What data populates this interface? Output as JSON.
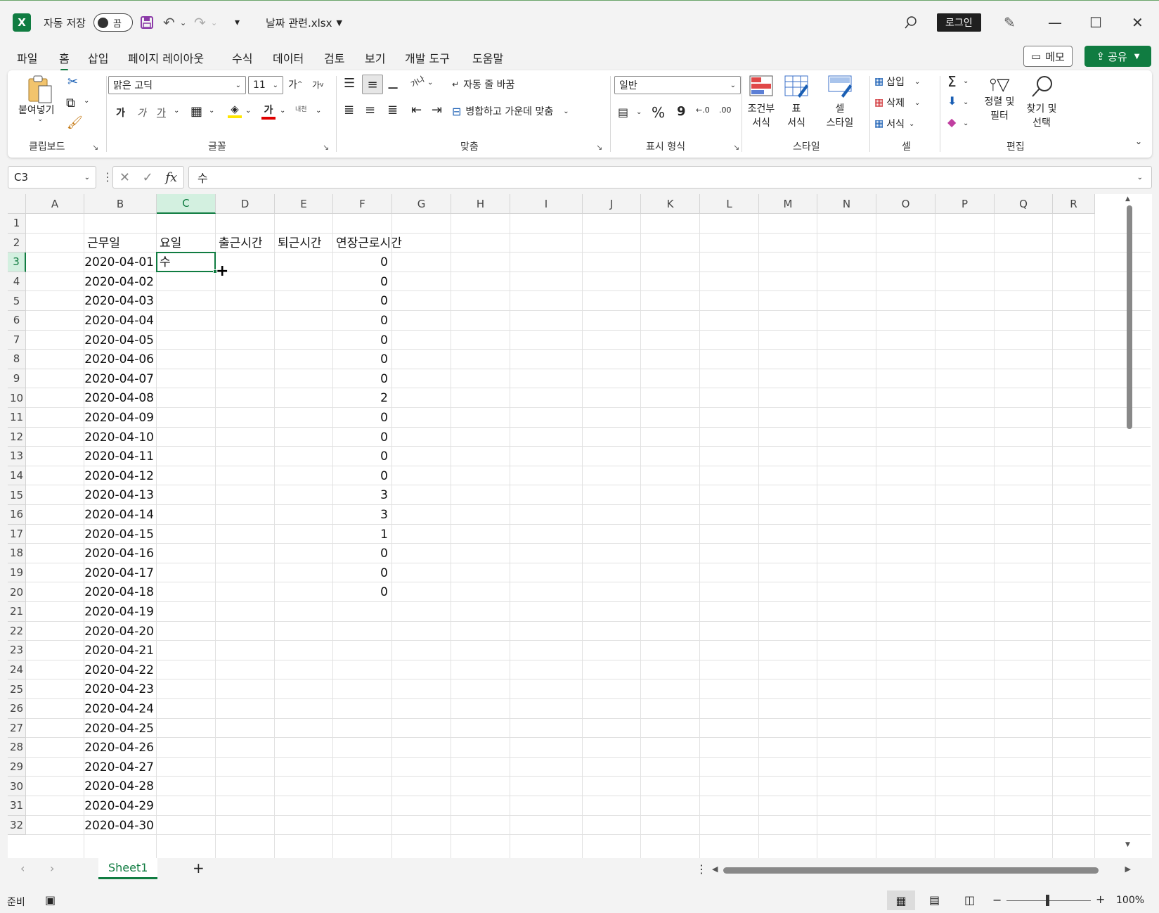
{
  "title_bar": {
    "app_icon": "X",
    "autosave_label": "자동 저장",
    "autosave_state": "끔",
    "filename": "날짜 관련.xlsx",
    "login_label": "로그인"
  },
  "menu": {
    "tabs": [
      "파일",
      "홈",
      "삽입",
      "페이지 레이아웃",
      "수식",
      "데이터",
      "검토",
      "보기",
      "개발 도구",
      "도움말"
    ],
    "active": "홈",
    "memo_label": "메모",
    "share_label": "공유"
  },
  "ribbon": {
    "clipboard": {
      "paste": "붙여넣기",
      "label": "클립보드"
    },
    "font": {
      "name": "맑은 고딕",
      "size": "11",
      "grow": "가",
      "shrink": "가",
      "bold": "가",
      "italic": "가",
      "underline": "가",
      "font_color": "가",
      "phonetic": "내천",
      "label": "글꼴"
    },
    "alignment": {
      "wrap": "자동 줄 바꿈",
      "merge": "병합하고 가운데 맞춤",
      "orientation": "가나",
      "label": "맞춤"
    },
    "number": {
      "format": "일반",
      "percent": "%",
      "comma": "9",
      "inc_decimal": "←.0",
      "dec_decimal": ".00",
      "label": "표시 형식"
    },
    "styles": {
      "conditional_top": "조건부",
      "conditional_bottom": "서식",
      "table_top": "표",
      "table_bottom": "서식",
      "cell_top": "셀",
      "cell_bottom": "스타일",
      "label": "스타일"
    },
    "cells": {
      "insert": "삽입",
      "delete": "삭제",
      "format": "서식",
      "label": "셀"
    },
    "editing": {
      "sum": "Σ",
      "sort_top": "정렬 및",
      "sort_bottom": "필터",
      "find_top": "찾기 및",
      "find_bottom": "선택",
      "label": "편집"
    }
  },
  "formula_bar": {
    "name_box": "C3",
    "fx": "fx",
    "content": "수"
  },
  "grid": {
    "columns": [
      "A",
      "B",
      "C",
      "D",
      "E",
      "F",
      "G",
      "H",
      "I",
      "J",
      "K",
      "L",
      "M",
      "N",
      "O",
      "P",
      "Q",
      "R"
    ],
    "selected_column": "C",
    "selected_row": 3,
    "headers": {
      "B": "근무일",
      "C": "요일",
      "D": "출근시간",
      "E": "퇴근시간",
      "F": "연장근로시간"
    },
    "rows": [
      {
        "n": "1",
        "b": "",
        "c": "",
        "f": ""
      },
      {
        "n": "2",
        "b": "",
        "c": "",
        "f": ""
      },
      {
        "n": "3",
        "b": "2020-04-01",
        "c": "수",
        "f": "0"
      },
      {
        "n": "4",
        "b": "2020-04-02",
        "c": "",
        "f": "0"
      },
      {
        "n": "5",
        "b": "2020-04-03",
        "c": "",
        "f": "0"
      },
      {
        "n": "6",
        "b": "2020-04-04",
        "c": "",
        "f": "0"
      },
      {
        "n": "7",
        "b": "2020-04-05",
        "c": "",
        "f": "0"
      },
      {
        "n": "8",
        "b": "2020-04-06",
        "c": "",
        "f": "0"
      },
      {
        "n": "9",
        "b": "2020-04-07",
        "c": "",
        "f": "0"
      },
      {
        "n": "10",
        "b": "2020-04-08",
        "c": "",
        "f": "2"
      },
      {
        "n": "11",
        "b": "2020-04-09",
        "c": "",
        "f": "0"
      },
      {
        "n": "12",
        "b": "2020-04-10",
        "c": "",
        "f": "0"
      },
      {
        "n": "13",
        "b": "2020-04-11",
        "c": "",
        "f": "0"
      },
      {
        "n": "14",
        "b": "2020-04-12",
        "c": "",
        "f": "0"
      },
      {
        "n": "15",
        "b": "2020-04-13",
        "c": "",
        "f": "3"
      },
      {
        "n": "16",
        "b": "2020-04-14",
        "c": "",
        "f": "3"
      },
      {
        "n": "17",
        "b": "2020-04-15",
        "c": "",
        "f": "1"
      },
      {
        "n": "18",
        "b": "2020-04-16",
        "c": "",
        "f": "0"
      },
      {
        "n": "19",
        "b": "2020-04-17",
        "c": "",
        "f": "0"
      },
      {
        "n": "20",
        "b": "2020-04-18",
        "c": "",
        "f": "0"
      },
      {
        "n": "21",
        "b": "2020-04-19",
        "c": "",
        "f": ""
      },
      {
        "n": "22",
        "b": "2020-04-20",
        "c": "",
        "f": ""
      },
      {
        "n": "23",
        "b": "2020-04-21",
        "c": "",
        "f": ""
      },
      {
        "n": "24",
        "b": "2020-04-22",
        "c": "",
        "f": ""
      },
      {
        "n": "25",
        "b": "2020-04-23",
        "c": "",
        "f": ""
      },
      {
        "n": "26",
        "b": "2020-04-24",
        "c": "",
        "f": ""
      },
      {
        "n": "27",
        "b": "2020-04-25",
        "c": "",
        "f": ""
      },
      {
        "n": "28",
        "b": "2020-04-26",
        "c": "",
        "f": ""
      },
      {
        "n": "29",
        "b": "2020-04-27",
        "c": "",
        "f": ""
      },
      {
        "n": "30",
        "b": "2020-04-28",
        "c": "",
        "f": ""
      },
      {
        "n": "31",
        "b": "2020-04-29",
        "c": "",
        "f": ""
      },
      {
        "n": "32",
        "b": "2020-04-30",
        "c": "",
        "f": ""
      }
    ]
  },
  "sheets": {
    "tabs": [
      "Sheet1"
    ],
    "active": "Sheet1",
    "add": "+"
  },
  "status": {
    "ready": "준비",
    "zoom": "100%",
    "minus": "−",
    "plus": "+"
  },
  "colors": {
    "accent": "#107c41",
    "selected_header_bg": "#d3f0e0"
  }
}
